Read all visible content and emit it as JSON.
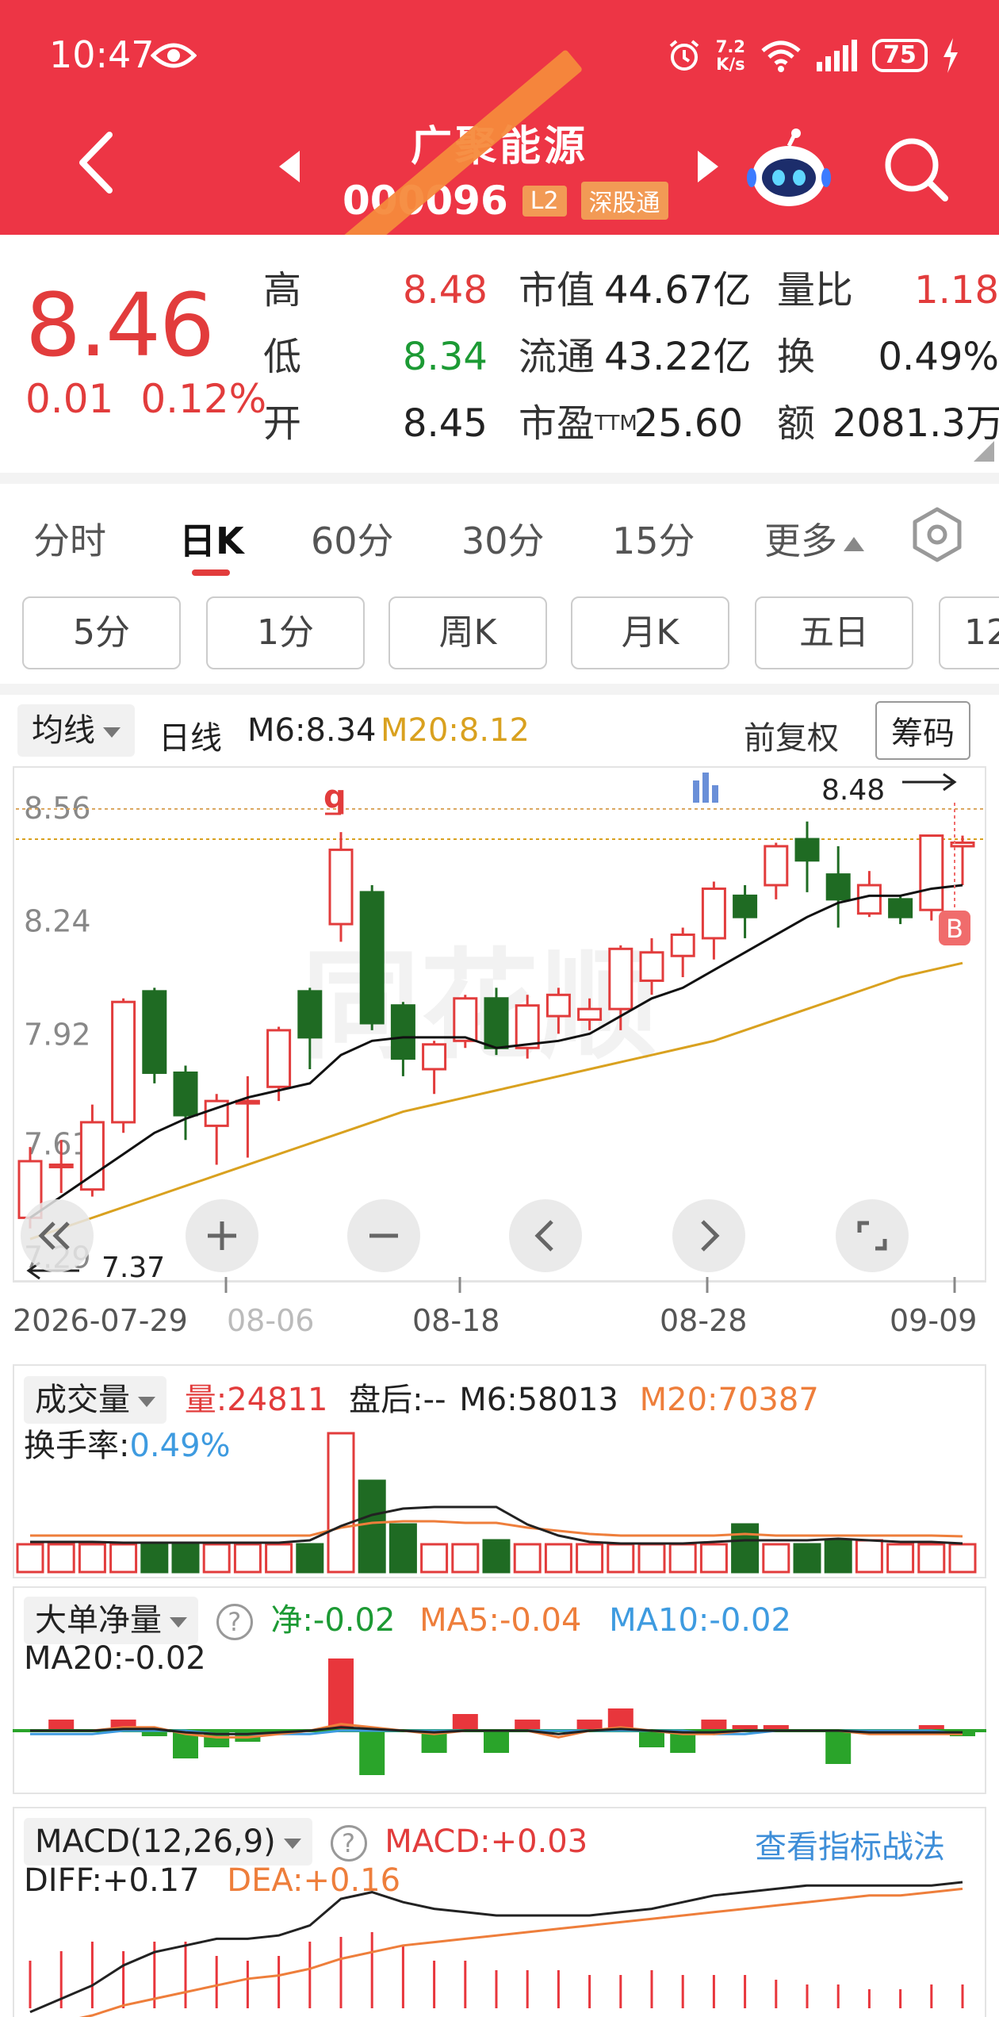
{
  "status": {
    "time": "10:47",
    "net_speed_top": "7.2",
    "net_speed_bottom": "K/s",
    "battery": "75"
  },
  "header": {
    "name": "广聚能源",
    "code": "000096",
    "code_visible": "00 ?96",
    "tags": [
      "L2",
      "深股通"
    ]
  },
  "quote": {
    "price": "8.46",
    "change": "0.01",
    "change_pct": "0.12%",
    "rows": [
      {
        "k1": "高",
        "v1": "8.48",
        "k2": "市值",
        "v2": "44.67亿",
        "k3": "量比",
        "v3": "1.18"
      },
      {
        "k1": "低",
        "v1": "8.34",
        "k2": "流通",
        "v2": "43.22亿",
        "k3": "换",
        "v3": "0.49%"
      },
      {
        "k1": "开",
        "v1": "8.45",
        "k2": "市盈",
        "k2_sup": "TTM",
        "v2": "25.60",
        "k3": "额",
        "v3": "2081.3万"
      }
    ]
  },
  "tabs": [
    "分时",
    "日K",
    "60分",
    "30分",
    "15分",
    "更多"
  ],
  "active_tab": "日K",
  "chips": [
    "5分",
    "1分",
    "周K",
    "月K",
    "五日",
    "12"
  ],
  "kline_head": {
    "select": "均线",
    "type": "日线",
    "m6": "M6:8.34",
    "m20": "M20:8.12",
    "adjust": "前复权",
    "chips_button": "筹码"
  },
  "colors": {
    "up": "#e23c3c",
    "down": "#1f6b23",
    "ma6": "#111111",
    "ma20": "#d9a11f",
    "brand": "#ed3545",
    "blue": "#3e9be0",
    "orange": "#ee7e3b"
  },
  "chart_data": [
    {
      "type": "candlestick",
      "title": "",
      "ylim": [
        7.3,
        8.6
      ],
      "y_ticks": [
        "8.56",
        "8.24",
        "7.92",
        "7.61",
        "7.29"
      ],
      "x_ticks": [
        "2026-07-29",
        "08-06",
        "08-18",
        "08-28",
        "09-09"
      ],
      "high_label": "8.48",
      "low_label": "7.37",
      "marker_q": "q",
      "marker_b": "B",
      "candles": [
        {
          "o": 7.4,
          "c": 7.56,
          "h": 7.6,
          "l": 7.37
        },
        {
          "o": 7.55,
          "c": 7.55,
          "h": 7.62,
          "l": 7.47
        },
        {
          "o": 7.48,
          "c": 7.67,
          "h": 7.72,
          "l": 7.46
        },
        {
          "o": 7.67,
          "c": 8.01,
          "h": 8.02,
          "l": 7.64
        },
        {
          "o": 8.04,
          "c": 7.81,
          "h": 8.05,
          "l": 7.78
        },
        {
          "o": 7.81,
          "c": 7.69,
          "h": 7.83,
          "l": 7.62
        },
        {
          "o": 7.66,
          "c": 7.73,
          "h": 7.75,
          "l": 7.55
        },
        {
          "o": 7.73,
          "c": 7.73,
          "h": 7.8,
          "l": 7.57
        },
        {
          "o": 7.77,
          "c": 7.93,
          "h": 7.94,
          "l": 7.73
        },
        {
          "o": 8.04,
          "c": 7.91,
          "h": 8.05,
          "l": 7.82
        },
        {
          "o": 8.23,
          "c": 8.44,
          "h": 8.49,
          "l": 8.18
        },
        {
          "o": 8.32,
          "c": 7.95,
          "h": 8.34,
          "l": 7.93
        },
        {
          "o": 8.0,
          "c": 7.85,
          "h": 8.01,
          "l": 7.8
        },
        {
          "o": 7.82,
          "c": 7.89,
          "h": 7.9,
          "l": 7.75
        },
        {
          "o": 7.9,
          "c": 8.02,
          "h": 8.03,
          "l": 7.88
        },
        {
          "o": 8.02,
          "c": 7.88,
          "h": 8.05,
          "l": 7.86
        },
        {
          "o": 7.88,
          "c": 8.0,
          "h": 8.03,
          "l": 7.85
        },
        {
          "o": 7.97,
          "c": 8.03,
          "h": 8.05,
          "l": 7.92
        },
        {
          "o": 7.96,
          "c": 7.99,
          "h": 8.02,
          "l": 7.93
        },
        {
          "o": 7.99,
          "c": 8.16,
          "h": 8.17,
          "l": 7.93
        },
        {
          "o": 8.07,
          "c": 8.15,
          "h": 8.19,
          "l": 8.03
        },
        {
          "o": 8.14,
          "c": 8.2,
          "h": 8.22,
          "l": 8.08
        },
        {
          "o": 8.19,
          "c": 8.33,
          "h": 8.35,
          "l": 8.13
        },
        {
          "o": 8.31,
          "c": 8.25,
          "h": 8.34,
          "l": 8.19
        },
        {
          "o": 8.34,
          "c": 8.45,
          "h": 8.46,
          "l": 8.3
        },
        {
          "o": 8.47,
          "c": 8.41,
          "h": 8.52,
          "l": 8.32
        },
        {
          "o": 8.37,
          "c": 8.3,
          "h": 8.45,
          "l": 8.22
        },
        {
          "o": 8.26,
          "c": 8.34,
          "h": 8.38,
          "l": 8.25
        },
        {
          "o": 8.3,
          "c": 8.25,
          "h": 8.31,
          "l": 8.23
        },
        {
          "o": 8.27,
          "c": 8.48,
          "h": 8.48,
          "l": 8.24
        },
        {
          "o": 8.45,
          "c": 8.46,
          "h": 8.48,
          "l": 8.34
        }
      ],
      "ma6": [
        7.4,
        7.46,
        7.52,
        7.58,
        7.64,
        7.68,
        7.71,
        7.74,
        7.76,
        7.78,
        7.86,
        7.9,
        7.91,
        7.91,
        7.91,
        7.88,
        7.89,
        7.9,
        7.92,
        7.97,
        8.02,
        8.05,
        8.1,
        8.15,
        8.2,
        8.25,
        8.29,
        8.31,
        8.31,
        8.33,
        8.34
      ],
      "ma20": [
        7.34,
        7.37,
        7.4,
        7.43,
        7.46,
        7.49,
        7.52,
        7.55,
        7.58,
        7.61,
        7.64,
        7.67,
        7.7,
        7.72,
        7.74,
        7.76,
        7.78,
        7.8,
        7.82,
        7.84,
        7.86,
        7.88,
        7.9,
        7.93,
        7.96,
        7.99,
        8.02,
        8.05,
        8.08,
        8.1,
        8.12
      ]
    },
    {
      "type": "bar",
      "title": "成交量",
      "labels": {
        "vol": "量:24811",
        "after": "盘后:-- ",
        "m6": "M6:58013",
        "m20": "M20:70387",
        "turnover_key": "换手率:",
        "turnover_val": "0.49%"
      },
      "values": [
        35,
        35,
        35,
        35,
        35,
        35,
        35,
        35,
        35,
        35,
        175,
        115,
        60,
        35,
        35,
        40,
        35,
        35,
        35,
        35,
        35,
        35,
        35,
        60,
        35,
        35,
        40,
        40,
        35,
        35,
        35
      ],
      "up": [
        1,
        1,
        1,
        1,
        0,
        0,
        1,
        1,
        1,
        0,
        1,
        0,
        0,
        1,
        1,
        0,
        1,
        1,
        1,
        1,
        1,
        1,
        1,
        0,
        1,
        0,
        0,
        1,
        1,
        1,
        1
      ],
      "ma6": [
        38,
        38,
        38,
        37,
        37,
        37,
        37,
        37,
        37,
        40,
        58,
        72,
        80,
        82,
        82,
        82,
        60,
        46,
        38,
        36,
        36,
        36,
        38,
        40,
        40,
        40,
        42,
        40,
        38,
        38,
        36
      ],
      "ma20": [
        46,
        46,
        46,
        46,
        46,
        46,
        46,
        46,
        46,
        46,
        56,
        62,
        64,
        64,
        62,
        62,
        56,
        52,
        48,
        46,
        46,
        46,
        46,
        48,
        46,
        46,
        46,
        46,
        46,
        46,
        45
      ]
    },
    {
      "type": "bar",
      "title": "大单净量",
      "labels": {
        "net": "净:-0.02",
        "ma5": "MA5:-0.04",
        "ma10": "MA10:-0.02",
        "ma20": "MA20:-0.02"
      },
      "values": [
        0,
        0.02,
        0,
        0.02,
        -0.01,
        -0.05,
        -0.03,
        -0.02,
        0,
        0,
        0.13,
        -0.08,
        0,
        -0.04,
        0.03,
        -0.04,
        0.02,
        0,
        0.02,
        0.04,
        -0.03,
        -0.04,
        0.02,
        0.01,
        0.01,
        0,
        -0.06,
        0,
        0,
        0.01,
        -0.01
      ],
      "ma5": [
        0,
        0,
        0,
        0.01,
        0.01,
        -0.01,
        -0.02,
        -0.02,
        -0.01,
        0,
        0.02,
        0.01,
        0,
        -0.01,
        0,
        0,
        0,
        -0.02,
        0,
        0.01,
        0,
        -0.01,
        -0.01,
        0,
        0,
        0,
        0,
        -0.01,
        -0.01,
        -0.01,
        -0.01
      ],
      "ma10": [
        -0.01,
        -0.01,
        -0.01,
        0,
        0,
        0,
        -0.01,
        -0.01,
        -0.01,
        -0.01,
        0,
        0,
        0,
        0,
        0,
        0,
        0,
        0,
        0,
        0,
        0,
        0,
        -0.01,
        -0.01,
        0,
        0,
        0,
        0,
        0,
        0,
        -0.01
      ],
      "ma20": [
        0,
        0,
        0,
        0,
        0,
        0,
        0,
        0,
        0,
        0,
        0,
        0,
        0,
        0,
        0,
        0,
        0,
        0,
        0,
        0,
        0,
        0,
        0,
        0,
        0,
        0,
        0,
        0,
        0,
        0,
        0
      ]
    },
    {
      "type": "bar",
      "title": "MACD(12,26,9)",
      "labels": {
        "macd": "MACD:+0.03",
        "diff": "DIFF:+0.17",
        "dea": "DEA:+0.16",
        "link": "查看指标战法"
      },
      "macd": [
        0.1,
        0.12,
        0.14,
        0.12,
        0.14,
        0.14,
        0.11,
        0.1,
        0.11,
        0.14,
        0.15,
        0.16,
        0.13,
        0.1,
        0.1,
        0.08,
        0.08,
        0.08,
        0.07,
        0.07,
        0.08,
        0.07,
        0.07,
        0.07,
        0.06,
        0.05,
        0.05,
        0.04,
        0.04,
        0.05,
        0.05
      ],
      "diff": [
        -0.14,
        -0.1,
        -0.06,
        0,
        0.04,
        0.06,
        0.08,
        0.08,
        0.09,
        0.12,
        0.2,
        0.22,
        0.19,
        0.17,
        0.16,
        0.15,
        0.15,
        0.15,
        0.15,
        0.16,
        0.17,
        0.19,
        0.21,
        0.22,
        0.23,
        0.24,
        0.24,
        0.24,
        0.24,
        0.24,
        0.25
      ],
      "dea": [
        -0.2,
        -0.17,
        -0.15,
        -0.12,
        -0.1,
        -0.08,
        -0.06,
        -0.04,
        -0.03,
        -0.01,
        0.02,
        0.04,
        0.06,
        0.07,
        0.08,
        0.09,
        0.1,
        0.11,
        0.12,
        0.13,
        0.14,
        0.15,
        0.16,
        0.17,
        0.18,
        0.19,
        0.2,
        0.21,
        0.21,
        0.22,
        0.23
      ]
    }
  ]
}
